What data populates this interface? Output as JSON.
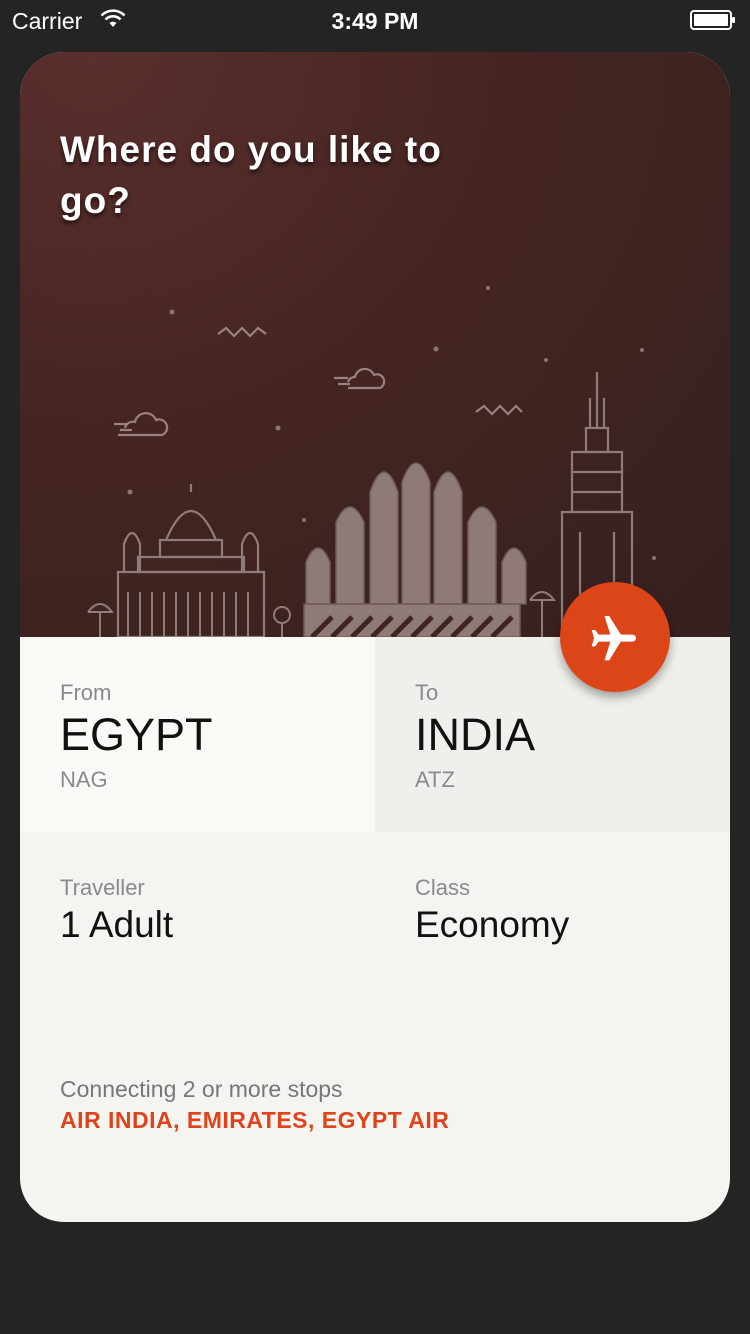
{
  "status_bar": {
    "carrier": "Carrier",
    "time": "3:49 PM"
  },
  "hero": {
    "title": "Where do you like to go?",
    "background_color": "#452522"
  },
  "route": {
    "from": {
      "label": "From",
      "country": "EGYPT",
      "code": "NAG"
    },
    "to": {
      "label": "To",
      "country": "INDIA",
      "code": "ATZ"
    }
  },
  "details": {
    "traveller": {
      "label": "Traveller",
      "value": "1 Adult"
    },
    "class": {
      "label": "Class",
      "value": "Economy"
    }
  },
  "stops": {
    "text": "Connecting 2 or more stops",
    "airlines": "AIR INDIA, EMIRATES, EGYPT AIR"
  },
  "icons": {
    "fab": "airplane-icon",
    "wifi": "wifi-icon",
    "battery": "battery-icon"
  },
  "colors": {
    "accent": "#dc4518",
    "airlines_text": "#e2421a",
    "page_background": "#242424"
  }
}
